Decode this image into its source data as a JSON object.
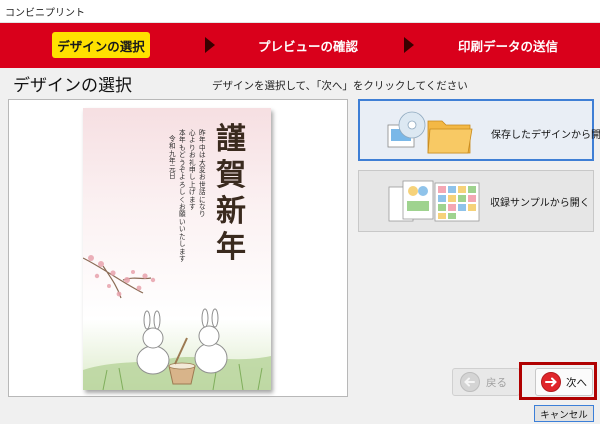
{
  "window": {
    "title": "コンビニプリント"
  },
  "steps": [
    {
      "label": "デザインの選択",
      "active": true
    },
    {
      "label": "プレビューの確認",
      "active": false
    },
    {
      "label": "印刷データの送信",
      "active": false
    }
  ],
  "page": {
    "title": "デザインの選択",
    "instruction": "デザインを選択して、「次へ」をクリックしてください"
  },
  "card": {
    "main_text": [
      "謹",
      "賀",
      "新",
      "年"
    ],
    "message_lines": [
      "昨年中は大変お世話になり",
      "心よりお礼申し上げます",
      "本年もどうぞよろしくお願いいたします",
      "令和九年　元日"
    ]
  },
  "options": {
    "open_saved": "保存したデザインから開く",
    "open_sample": "収録サンプルから開く"
  },
  "nav": {
    "back": "戻る",
    "next": "次へ",
    "cancel": "キャンセル"
  },
  "colors": {
    "step_bar": "#d9001b",
    "step_active": "#ffe100",
    "next_highlight": "#b00000",
    "next_icon": "#e0262b"
  }
}
